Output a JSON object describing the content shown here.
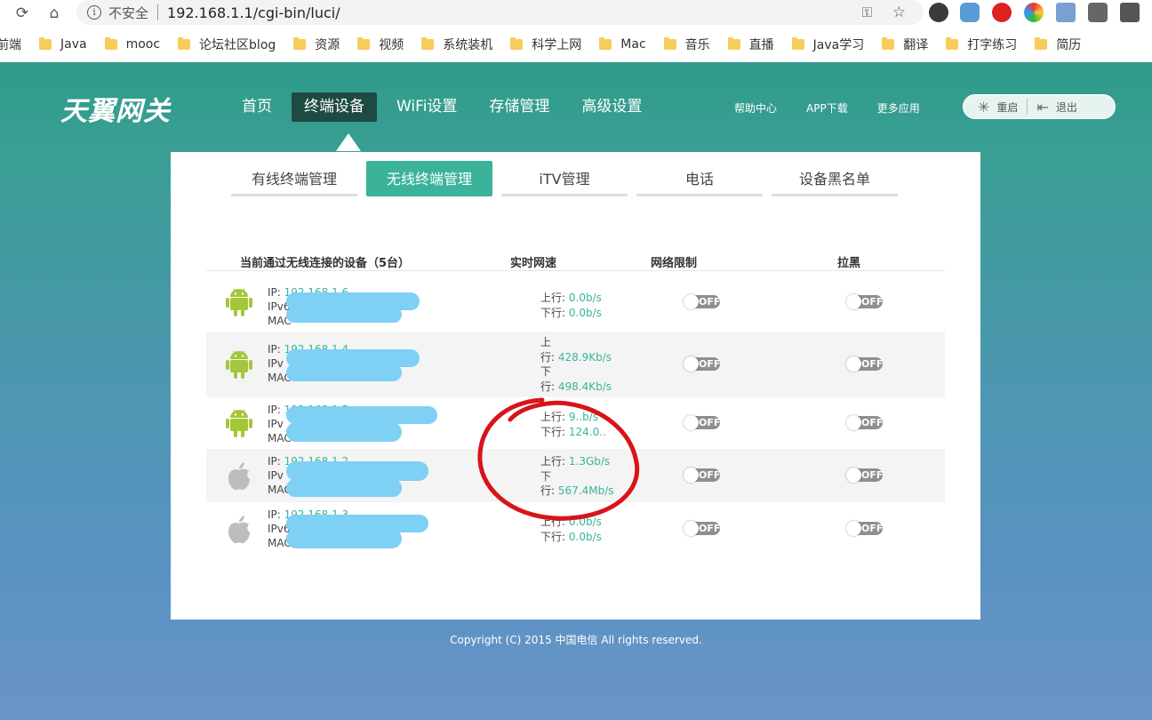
{
  "browser": {
    "security_label": "不安全",
    "url": "192.168.1.1/cgi-bin/luci/",
    "bookmarks": [
      "前端",
      "Java",
      "mooc",
      "论坛社区blog",
      "资源",
      "视频",
      "系统装机",
      "科学上网",
      "Mac",
      "音乐",
      "直播",
      "Java学习",
      "翻译",
      "打字练习",
      "简历"
    ]
  },
  "router": {
    "logo": "天翼网关",
    "nav": [
      "首页",
      "终端设备",
      "WiFi设置",
      "存储管理",
      "高级设置"
    ],
    "active_nav": "终端设备",
    "links": [
      "帮助中心",
      "APP下载",
      "更多应用"
    ],
    "restart_label": "重启",
    "logout_label": "退出",
    "tabs": [
      "有线终端管理",
      "无线终端管理",
      "iTV管理",
      "电话",
      "设备黑名单"
    ],
    "active_tab": "无线终端管理",
    "table_headers": {
      "devices": "当前通过无线连接的设备（5台）",
      "speed": "实时网速",
      "limit": "网络限制",
      "block": "拉黑"
    },
    "devices": [
      {
        "os_icon": "android-icon",
        "ip_label": "IP:",
        "ip": "192.168.1.6",
        "ipv6_label": "IPv6",
        "mac_label": "MAC",
        "up_label": "上行:",
        "up": "0.0b/s",
        "down_label": "下行:",
        "down": "0.0b/s",
        "limit": "OFF",
        "block": "OFF"
      },
      {
        "os_icon": "android-icon",
        "ip_label": "IP:",
        "ip": "192.168.1.4",
        "ipv6_label": "IPv",
        "mac_label": "MAC",
        "up_label": "上\n行:",
        "up": "428.9Kb/s",
        "down_label": "下\n行:",
        "down": "498.4Kb/s",
        "limit": "OFF",
        "block": "OFF"
      },
      {
        "os_icon": "android-icon",
        "ip_label": "IP:",
        "ip": "192.168.1.5",
        "ipv6_label": "IPv",
        "mac_label": "MAC",
        "up_label": "上行:",
        "up": "9..b/s",
        "down_label": "下行:",
        "down": "124.0..",
        "limit": "OFF",
        "block": "OFF"
      },
      {
        "os_icon": "apple-icon",
        "ip_label": "IP:",
        "ip": "192.168.1.2",
        "ipv6_label": "IPv",
        "mac_label": "MAC",
        "up_label": "上行:",
        "up": "1.3Gb/s",
        "down_label": "下\n行:",
        "down": "567.4Mb/s",
        "limit": "OFF",
        "block": "OFF"
      },
      {
        "os_icon": "apple-icon",
        "ip_label": "IP:",
        "ip": "192.168.1.3",
        "ipv6_label": "IPv6",
        "mac_label": "MAC",
        "up_label": "上行:",
        "up": "0.0b/s",
        "down_label": "下行:",
        "down": "0.0b/s",
        "limit": "OFF",
        "block": "OFF"
      }
    ],
    "copyright": "Copyright (C) 2015 中国电信 All rights reserved."
  },
  "colors": {
    "accent": "#3bb39a",
    "annotation": "#d8141a",
    "redaction": "#7ed0f5"
  }
}
